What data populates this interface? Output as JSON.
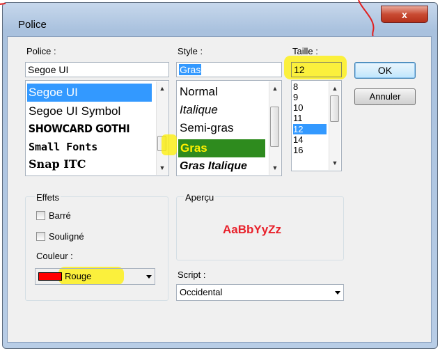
{
  "dialog": {
    "title": "Police",
    "close_glyph": "x"
  },
  "font": {
    "label": "Police :",
    "value": "Segoe UI",
    "items": [
      "Segoe UI",
      "Segoe UI Symbol",
      "SHOWCARD GOTHI",
      "Small Fonts",
      "Snap ITC"
    ],
    "selected": "Segoe UI"
  },
  "style": {
    "label": "Style :",
    "value": "Gras",
    "items": [
      "Normal",
      "Italique",
      "Semi-gras",
      "Gras",
      "Gras Italique"
    ],
    "selected": "Gras"
  },
  "size": {
    "label": "Taille :",
    "value": "12",
    "items": [
      "8",
      "9",
      "10",
      "11",
      "12",
      "14",
      "16"
    ],
    "selected": "12"
  },
  "buttons": {
    "ok": "OK",
    "cancel": "Annuler"
  },
  "effects": {
    "group_label": "Effets",
    "strikeout": "Barré",
    "underline": "Souligné",
    "color_label": "Couleur :",
    "color_value": "Rouge",
    "color_swatch": "#ff0000"
  },
  "preview": {
    "group_label": "Aperçu",
    "sample": "AaBbYyZz",
    "sample_color": "#e8202a"
  },
  "script": {
    "label": "Script :",
    "value": "Occidental"
  },
  "colors": {
    "selection": "#3399ff",
    "highlighter_yellow": "#fff000",
    "selected_style_bg": "#2e8b1e",
    "annotation_red": "#e02020"
  },
  "icons": {
    "close": "close-icon",
    "scroll_up": "scroll-up-icon",
    "scroll_down": "scroll-down-icon",
    "dropdown": "chevron-down-icon",
    "annotation": "red-arrow-annotation"
  }
}
